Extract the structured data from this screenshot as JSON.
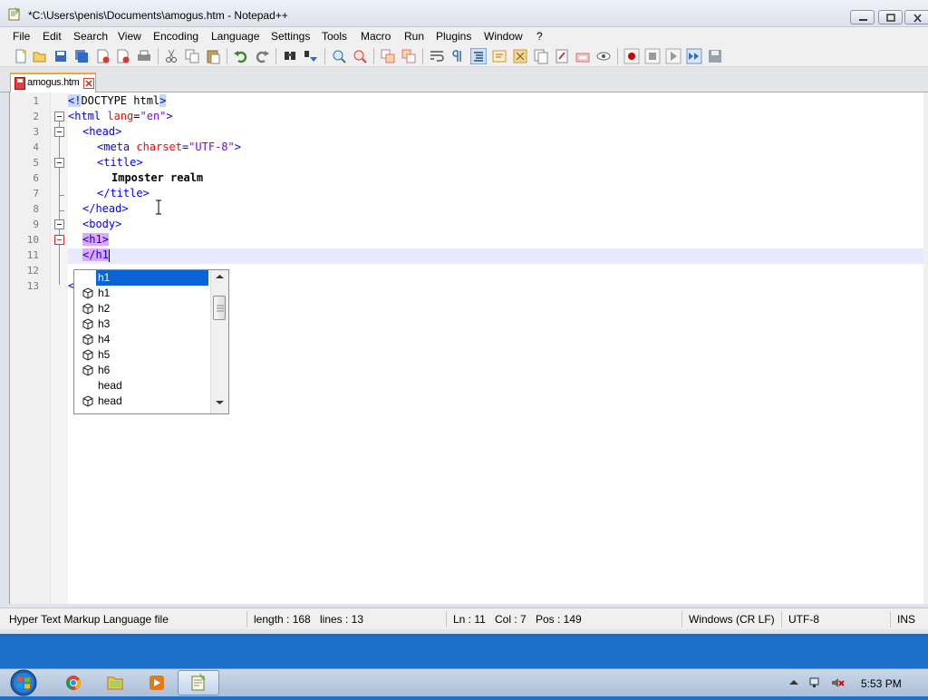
{
  "window": {
    "title": "*C:\\Users\\penis\\Documents\\amogus.htm - Notepad++"
  },
  "menu": [
    "File",
    "Edit",
    "Search",
    "View",
    "Encoding",
    "Language",
    "Settings",
    "Tools",
    "Macro",
    "Run",
    "Plugins",
    "Window",
    "?"
  ],
  "toolbar_icons": [
    "new-file-icon",
    "open-file-icon",
    "save-icon",
    "save-all-icon",
    "close-icon",
    "close-all-icon",
    "print-icon",
    "cut-icon",
    "copy-icon",
    "paste-icon",
    "undo-icon",
    "redo-icon",
    "find-icon",
    "replace-icon",
    "zoom-in-icon",
    "zoom-out-icon",
    "sync-vertical-icon",
    "sync-horizontal-icon",
    "word-wrap-icon",
    "show-all-characters-icon",
    "indent-guide-icon",
    "user-language-icon",
    "document-map-icon",
    "function-list-icon",
    "folder-workspace-icon",
    "monitoring-icon",
    "record-macro-icon",
    "stop-recording-icon",
    "play-macro-icon",
    "run-macro-multiple-icon",
    "save-macro-icon"
  ],
  "tab": {
    "label": "amogus.htm"
  },
  "editor": {
    "line_numbers": [
      "1",
      "2",
      "3",
      "4",
      "5",
      "6",
      "7",
      "8",
      "9",
      "10",
      "11",
      "12",
      "13"
    ],
    "code": {
      "l1_a": "<!",
      "l1_b": "DOCTYPE html",
      "l1_c": ">",
      "l2_tag": "<html ",
      "l2_attr": "lang",
      "l2_eq": "=",
      "l2_val": "\"en\"",
      "l2_end": ">",
      "l3": "<head>",
      "l4_tag": "<meta ",
      "l4_attr": "charset",
      "l4_eq": "=",
      "l4_val": "\"UTF-8\"",
      "l4_end": ">",
      "l5": "<title>",
      "l6": "Imposter realm",
      "l7": "</title>",
      "l8": "</head>",
      "l9": "<body>",
      "l10": "<h1>",
      "l11": "</h1",
      "l13": "<"
    }
  },
  "autocomplete": {
    "items": [
      {
        "label": "h1",
        "icon": "",
        "selected": true
      },
      {
        "label": "h1",
        "icon": "cube-icon",
        "selected": false
      },
      {
        "label": "h2",
        "icon": "cube-icon",
        "selected": false
      },
      {
        "label": "h3",
        "icon": "cube-icon",
        "selected": false
      },
      {
        "label": "h4",
        "icon": "cube-icon",
        "selected": false
      },
      {
        "label": "h5",
        "icon": "cube-icon",
        "selected": false
      },
      {
        "label": "h6",
        "icon": "cube-icon",
        "selected": false
      },
      {
        "label": "head",
        "icon": "",
        "selected": false
      },
      {
        "label": "head",
        "icon": "cube-icon",
        "selected": false
      }
    ]
  },
  "status": {
    "file_type": "Hyper Text Markup Language file",
    "length": "length : 168",
    "lines": "lines : 13",
    "ln": "Ln : 11",
    "col": "Col : 7",
    "pos": "Pos : 149",
    "eol": "Windows (CR LF)",
    "encoding": "UTF-8",
    "mode": "INS"
  },
  "taskbar": {
    "clock": "5:53 PM",
    "apps": [
      "chrome-icon",
      "file-explorer-icon",
      "media-player-icon",
      "notepad-plus-plus-icon"
    ]
  },
  "colors": {
    "tag": "#0000ff",
    "attribute": "#ff0000",
    "value": "#8000ff",
    "selection": "#0a64d8",
    "current_line": "#e8e8ff",
    "tag_match_highlight": "#e1a8ff"
  }
}
